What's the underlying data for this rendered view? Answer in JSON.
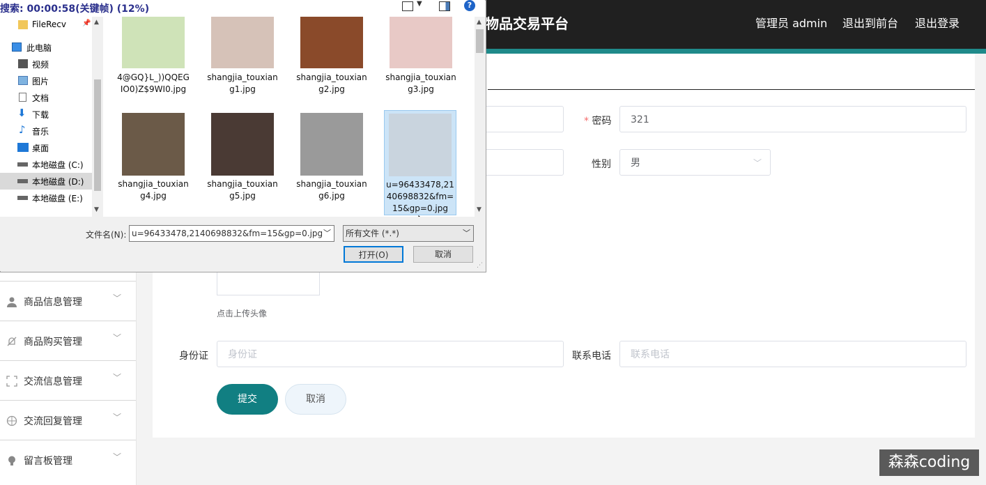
{
  "header": {
    "app_title": "物品交易平台",
    "admin_label": "管理员 admin",
    "to_front_label": "退出到前台",
    "logout_label": "退出登录"
  },
  "sidebar": {
    "items": [
      {
        "label": "商品信息管理",
        "icon": "user-icon"
      },
      {
        "label": "商品购买管理",
        "icon": "bell-off-icon"
      },
      {
        "label": "交流信息管理",
        "icon": "fullscreen-icon"
      },
      {
        "label": "交流回复管理",
        "icon": "target-icon"
      },
      {
        "label": "留言板管理",
        "icon": "bulb-icon"
      }
    ]
  },
  "form": {
    "password_label": "密码",
    "password_value": "321",
    "gender_label": "性别",
    "gender_value": "男",
    "avatar_hint": "点击上传头像",
    "idcard_label": "身份证",
    "idcard_placeholder": "身份证",
    "phone_label": "联系电话",
    "phone_placeholder": "联系电话",
    "submit_label": "提交",
    "cancel_label": "取消"
  },
  "dialog": {
    "title": "搜索: 00:00:58(关键帧) (12%)",
    "nav_items": [
      {
        "label": "FileRecv",
        "icon": "folder-icon"
      },
      {
        "label": "此电脑",
        "icon": "computer-icon"
      },
      {
        "label": "视频",
        "icon": "video-icon"
      },
      {
        "label": "图片",
        "icon": "picture-icon"
      },
      {
        "label": "文档",
        "icon": "document-icon"
      },
      {
        "label": "下载",
        "icon": "download-icon"
      },
      {
        "label": "音乐",
        "icon": "music-icon"
      },
      {
        "label": "桌面",
        "icon": "desktop-icon"
      },
      {
        "label": "本地磁盘 (C:)",
        "icon": "drive-icon"
      },
      {
        "label": "本地磁盘 (D:)",
        "icon": "drive-icon"
      },
      {
        "label": "本地磁盘 (E:)",
        "icon": "drive-icon"
      }
    ],
    "files": [
      {
        "name": "4@GQ}L_))QQEGIO0)Z$9WI0.jpg",
        "color": "#cfe3b8"
      },
      {
        "name": "shangjia_touxiang1.jpg",
        "color": "#d6c2b8"
      },
      {
        "name": "shangjia_touxiang2.jpg",
        "color": "#8a4a2a"
      },
      {
        "name": "shangjia_touxiang3.jpg",
        "color": "#e8c9c6"
      },
      {
        "name": "shangjia_touxiang4.jpg",
        "color": "#6b5a48"
      },
      {
        "name": "shangjia_touxiang5.jpg",
        "color": "#4a3a34"
      },
      {
        "name": "shangjia_touxiang6.jpg",
        "color": "#9a9a9a"
      },
      {
        "name": "u=96433478,2140698832&fm=15&gp=0.jpg",
        "color": "#c9d4de"
      }
    ],
    "filename_label": "文件名(N):",
    "filename_value": "u=96433478,2140698832&fm=15&gp=0.jpg",
    "filetype_value": "所有文件 (*.*)",
    "open_label": "打开(O)",
    "cancel_label": "取消"
  },
  "watermark": "森森coding",
  "colors": {
    "header_bg": "#202020",
    "accent": "#1f8a8a",
    "submit_bg": "#117f82"
  }
}
